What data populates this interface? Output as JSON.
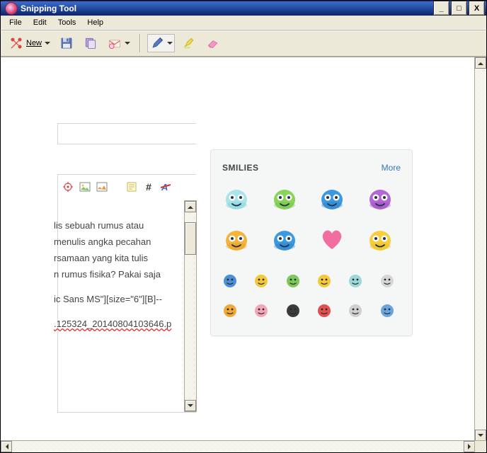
{
  "window": {
    "title": "Snipping Tool",
    "buttons": {
      "min": "_",
      "max": "□",
      "close": "X"
    }
  },
  "menu": {
    "file": "File",
    "edit": "Edit",
    "tools": "Tools",
    "help": "Help"
  },
  "toolbar": {
    "new_label": "New"
  },
  "editor": {
    "lines": [
      "lis sebuah rumus atau",
      "menulis angka pecahan",
      "rsamaan yang kita tulis",
      "n rumus fisika? Pakai saja"
    ],
    "line2": "ic Sans MS\"][size=\"6\"][B]--",
    "line3": ".125324_20140804103646.p"
  },
  "smilies": {
    "title": "SMILIES",
    "more": "More",
    "big": [
      {
        "name": "ghost-cyan",
        "body": "#a9e4ea",
        "face": "#7ecfd6"
      },
      {
        "name": "alien-green",
        "body": "#8bd45c",
        "face": "#6bbf3e"
      },
      {
        "name": "blob-blue",
        "body": "#3a99e0",
        "face": "#2b7fc0"
      },
      {
        "name": "princess-purple",
        "body": "#b367d6",
        "face": "#9a4cc1"
      },
      {
        "name": "grin-orange",
        "body": "#f4b33a",
        "face": "#e79a20"
      },
      {
        "name": "eyes-blue",
        "body": "#3a99e0",
        "face": "#2b7fc0"
      },
      {
        "name": "heart-pink",
        "body": "#f06fa0",
        "face": "#e0558b"
      },
      {
        "name": "smile-yellow",
        "body": "#f7cf3c",
        "face": "#e8bb1d"
      }
    ],
    "small": [
      {
        "name": "robot-blue",
        "c": "#4b8fd6"
      },
      {
        "name": "wink-yellow",
        "c": "#f3c93b"
      },
      {
        "name": "leaf-green",
        "c": "#7cc95a"
      },
      {
        "name": "blush-yellow",
        "c": "#f3c93b"
      },
      {
        "name": "wave-teal",
        "c": "#9ad8da"
      },
      {
        "name": "flag-grey",
        "c": "#d6d6d6"
      },
      {
        "name": "hmm-orange",
        "c": "#f0a838"
      },
      {
        "name": "pig-pink",
        "c": "#f2a6b8"
      },
      {
        "name": "dark-ball",
        "c": "#3b3b3b"
      },
      {
        "name": "angry-red",
        "c": "#e05050"
      },
      {
        "name": "dizzy-grey",
        "c": "#cfcfcf"
      },
      {
        "name": "sign-blue",
        "c": "#6aa6dd"
      }
    ]
  }
}
